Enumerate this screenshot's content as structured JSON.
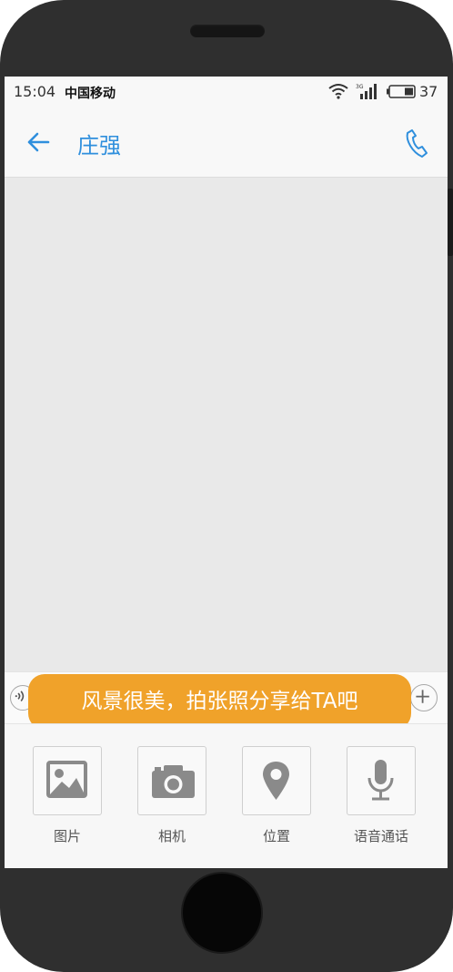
{
  "status": {
    "time": "15:04",
    "carrier": "中国移动",
    "signal_type": "3G",
    "battery": "37"
  },
  "header": {
    "back_icon": "arrow-left-icon",
    "title": "庄强",
    "call_icon": "phone-icon"
  },
  "toast": {
    "text": "风景很美，拍张照分享给TA吧"
  },
  "panel": {
    "items": [
      {
        "label": "图片",
        "icon": "image-icon"
      },
      {
        "label": "相机",
        "icon": "camera-icon"
      },
      {
        "label": "位置",
        "icon": "location-pin-icon"
      },
      {
        "label": "语音通话",
        "icon": "microphone-icon"
      }
    ]
  },
  "colors": {
    "accent": "#2f8fdd",
    "toast": "#f0a22a",
    "chat_background": "#e9e9e9"
  }
}
